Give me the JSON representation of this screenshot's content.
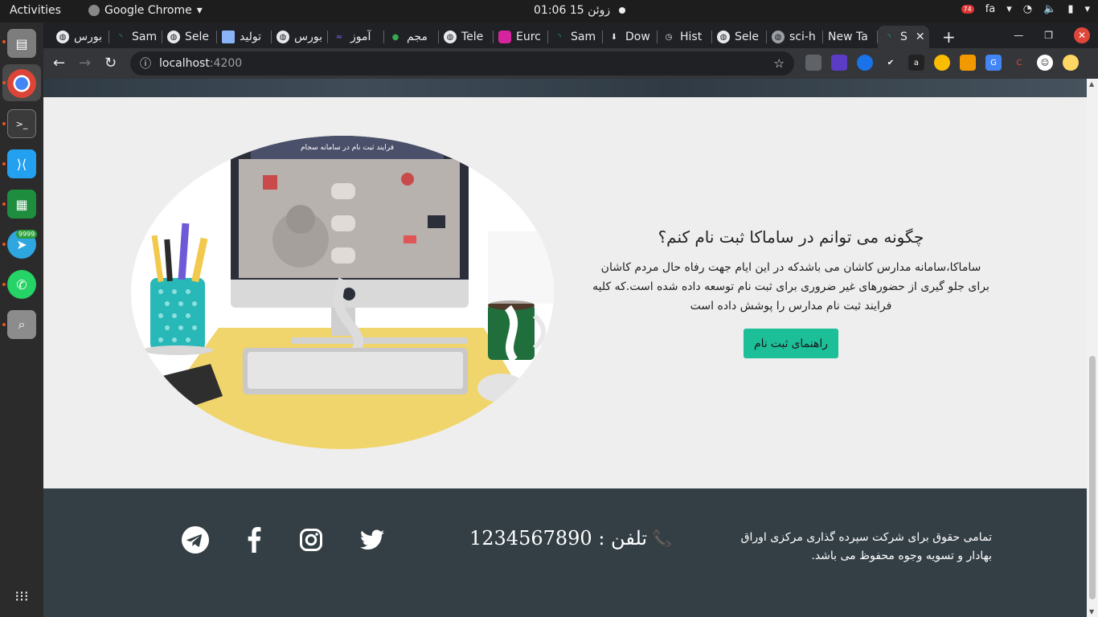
{
  "system": {
    "activities": "Activities",
    "app_name": "Google Chrome",
    "clock": "زوئن 15  01:06",
    "lang": "fa",
    "notif_count": "74",
    "telegram_badge": "9999"
  },
  "tabs": [
    {
      "label": "بورس"
    },
    {
      "label": "Sam"
    },
    {
      "label": "Sele"
    },
    {
      "label": "تولید"
    },
    {
      "label": "بورس"
    },
    {
      "label": "آموز"
    },
    {
      "label": "مجم"
    },
    {
      "label": "Tele"
    },
    {
      "label": "Eurc"
    },
    {
      "label": "Sam"
    },
    {
      "label": "Dow"
    },
    {
      "label": "Hist"
    },
    {
      "label": "Sele"
    },
    {
      "label": "sci-h"
    },
    {
      "label": "New Ta"
    },
    {
      "label": "S"
    }
  ],
  "omnibox": {
    "host": "localhost",
    "port": ":4200"
  },
  "illustration": {
    "screen_title": "فرایند ثبت نام در سامانه سجام"
  },
  "content": {
    "heading": "چگونه می توانم در ساماکا ثبت نام کنم؟",
    "body": "ساماکا،سامانه مدارس کاشان می باشدکه در این ایام جهت رفاه حال مردم کاشان برای جلو گیری از حضورهای غیر ضروری برای ثبت نام توسعه داده شده است.که کلیه فرایند ثبت نام مدارس را پوشش داده است",
    "button": "راهنمای ثبت نام"
  },
  "footer": {
    "copyright": "تمامی حقوق برای شرکت سپرده گذاری مرکزی اوراق بهادار و تسویه وجوه محفوظ می باشد.",
    "phone_label": "تلفن : 1234567890"
  },
  "colors": {
    "accent": "#1cbf98",
    "footer_bg": "#343f45",
    "page_bg": "#eeeeee"
  }
}
